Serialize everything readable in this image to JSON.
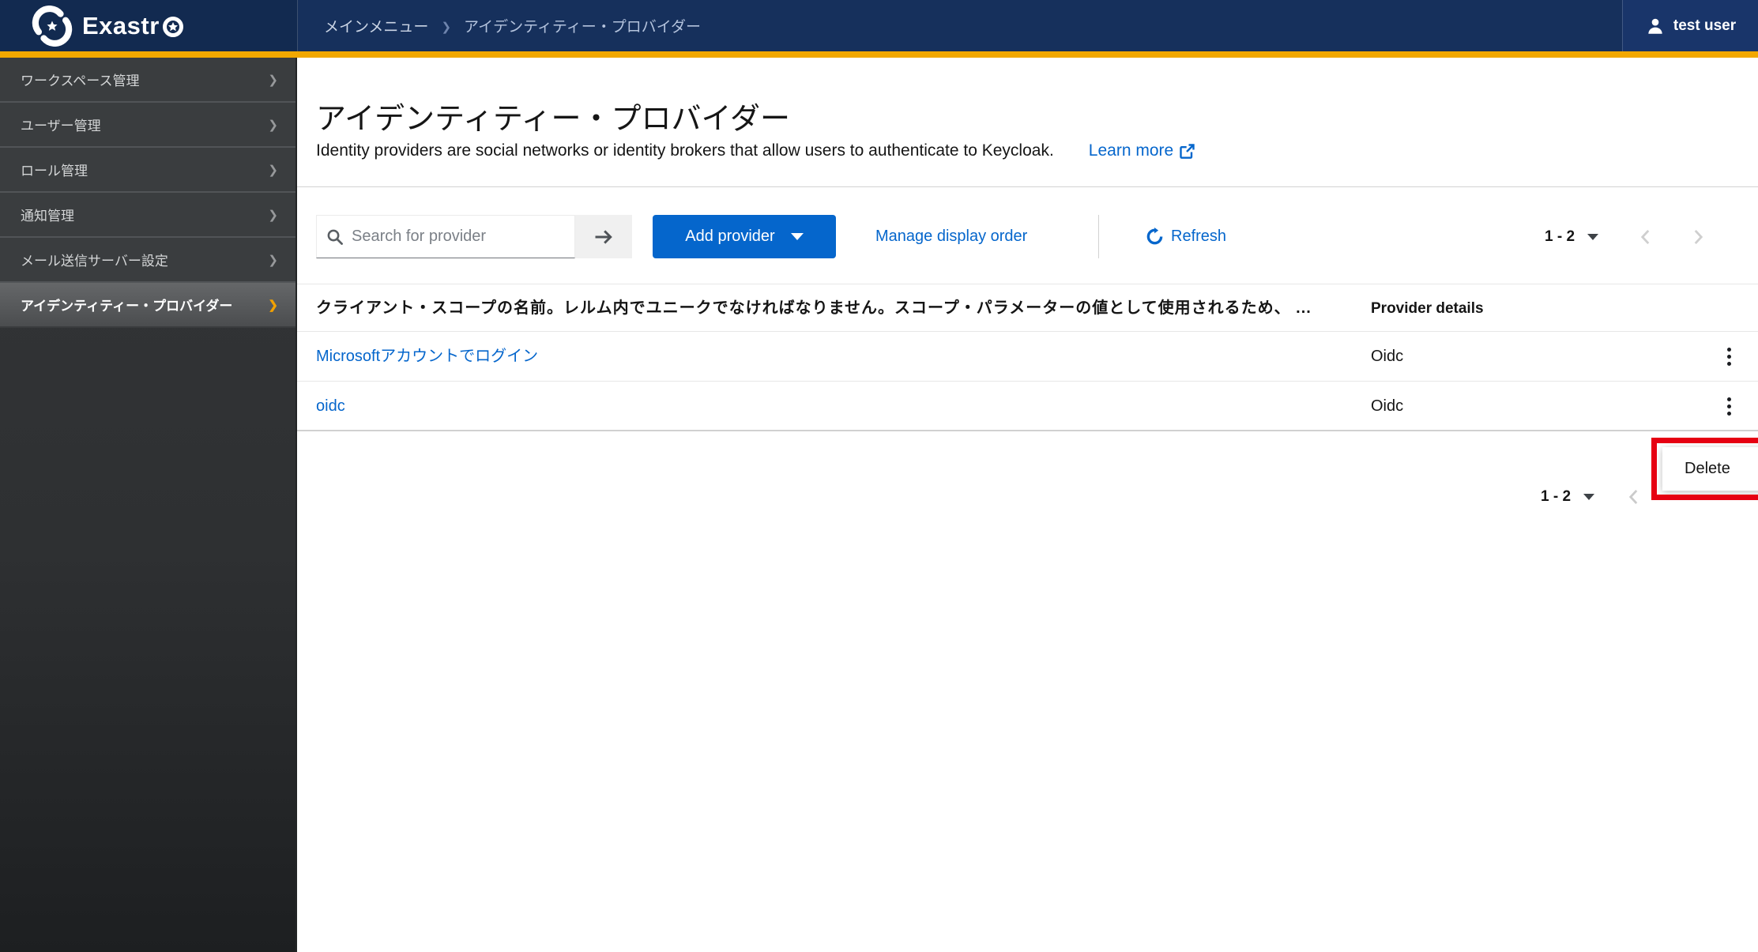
{
  "header": {
    "logo_text": "Exastr",
    "breadcrumb": {
      "items": [
        "メインメニュー",
        "アイデンティティー・プロバイダー"
      ]
    },
    "user_label": "test user"
  },
  "sidebar": {
    "items": [
      {
        "label": "ワークスペース管理",
        "active": false
      },
      {
        "label": "ユーザー管理",
        "active": false
      },
      {
        "label": "ロール管理",
        "active": false
      },
      {
        "label": "通知管理",
        "active": false
      },
      {
        "label": "メール送信サーバー設定",
        "active": false
      },
      {
        "label": "アイデンティティー・プロバイダー",
        "active": true
      }
    ]
  },
  "main": {
    "title": "アイデンティティー・プロバイダー",
    "description": "Identity providers are social networks or identity brokers that allow users to authenticate to Keycloak.",
    "learn_more_label": "Learn more",
    "toolbar": {
      "search_placeholder": "Search for provider",
      "add_provider_label": "Add provider",
      "manage_display_order_label": "Manage display order",
      "refresh_label": "Refresh",
      "pagination_label": "1 - 2"
    },
    "table": {
      "name_column_header": "クライアント・スコープの名前。レルム内でユニークでなければなりません。スコープ・パラメーターの値として使用されるため、 ...",
      "details_column_header": "Provider details",
      "rows": [
        {
          "name": "Microsoftアカウントでログイン",
          "provider_details": "Oidc"
        },
        {
          "name": "oidc",
          "provider_details": "Oidc"
        }
      ]
    },
    "row_actions_menu": {
      "delete_label": "Delete"
    },
    "bottom_pagination_label": "1 - 2"
  },
  "icons": {
    "sidebar_chevron": "❯",
    "breadcrumb_separator": "❯"
  },
  "colors": {
    "header_navy": "#16305c",
    "accent_gold": "#f2a800",
    "primary_blue": "#0566cc",
    "link_blue": "#0566cc",
    "sidebar_dark": "#3a3d3f",
    "text_dark": "#151515",
    "annotation_red": "#e60012"
  }
}
